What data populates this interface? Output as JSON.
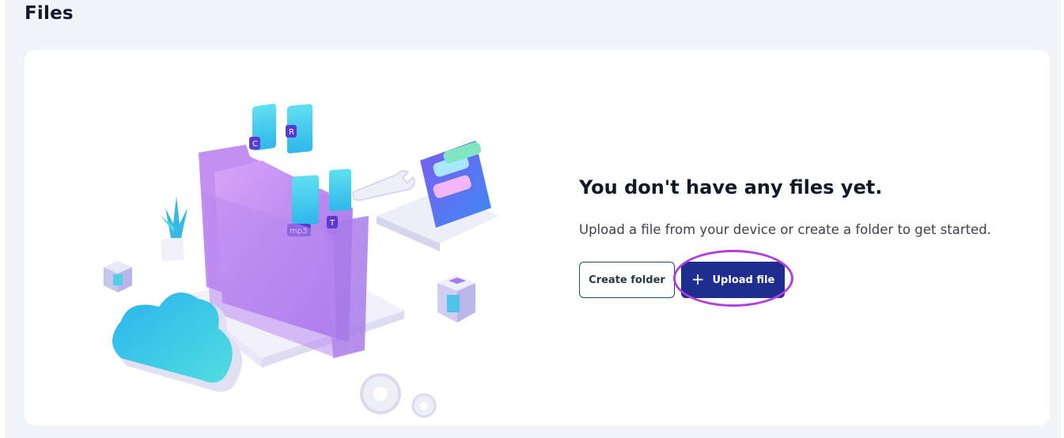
{
  "page": {
    "title": "Files"
  },
  "empty_state": {
    "heading": "You don't have any files yet.",
    "description": "Upload a file from your device or create a folder to get started.",
    "create_folder_label": "Create folder",
    "upload_file_label": "Upload file"
  },
  "illustration": {
    "file_tags": [
      "C",
      "R",
      "mp3",
      "T"
    ]
  },
  "colors": {
    "primary": "#1f2d8f",
    "outline": "#1f4b63",
    "highlight": "#b23ee0",
    "background": "#f3f4fa"
  }
}
